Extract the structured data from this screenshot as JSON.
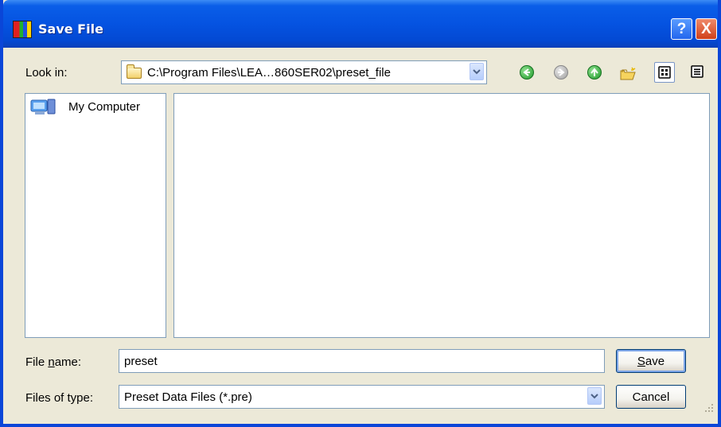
{
  "window": {
    "title": "Save File",
    "help_symbol": "?",
    "close_symbol": "X"
  },
  "look_in": {
    "label": "Look in:",
    "path": "C:\\Program Files\\LEA…860SER02\\preset_file"
  },
  "tree": {
    "my_computer": "My Computer"
  },
  "file_name": {
    "label_prefix": "File ",
    "label_accel": "n",
    "label_suffix": "ame:",
    "value": "preset"
  },
  "files_of_type": {
    "label": "Files of type:",
    "selected": "Preset Data Files (*.pre)"
  },
  "buttons": {
    "save_accel": "S",
    "save_rest": "ave",
    "cancel": "Cancel"
  },
  "icons": {
    "app": "app-icon",
    "folder": "folder-icon",
    "back": "back-arrow-icon",
    "forward": "forward-arrow-icon",
    "up": "up-folder-icon",
    "new_folder": "new-folder-icon",
    "list": "list-view-icon",
    "details": "details-view-icon",
    "computer": "my-computer-icon",
    "dropdown": "chevron-down-icon"
  },
  "colors": {
    "titlebar": "#0553e1",
    "face": "#ece9d8",
    "border": "#7f9db9"
  }
}
